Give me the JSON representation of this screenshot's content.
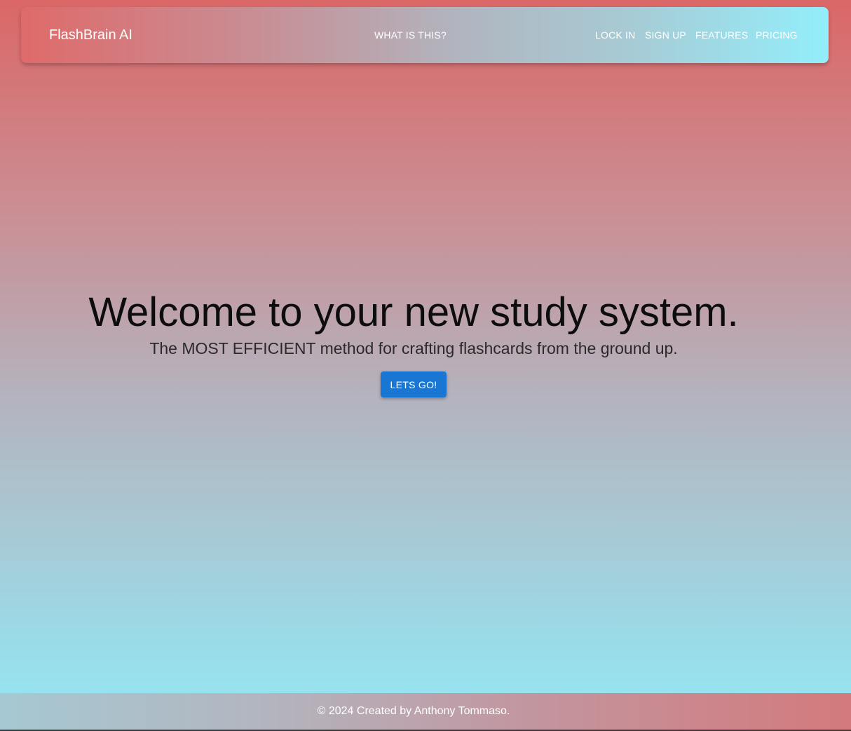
{
  "navbar": {
    "brand": "FlashBrain AI",
    "center_link": "WHAT IS THIS?",
    "links": [
      "LOCK IN",
      "SIGN UP",
      "FEATURES",
      "PRICING"
    ]
  },
  "hero": {
    "title": "Welcome to your new study system.",
    "subtitle": "The MOST EFFICIENT method for crafting flashcards from the ground up.",
    "cta_label": "LETS GO!"
  },
  "footer": {
    "text": "© 2024 Created by Anthony Tommaso."
  },
  "colors": {
    "accent": "#1976d2",
    "gradient_top": "#db6767",
    "gradient_bottom": "#95e8f4"
  }
}
